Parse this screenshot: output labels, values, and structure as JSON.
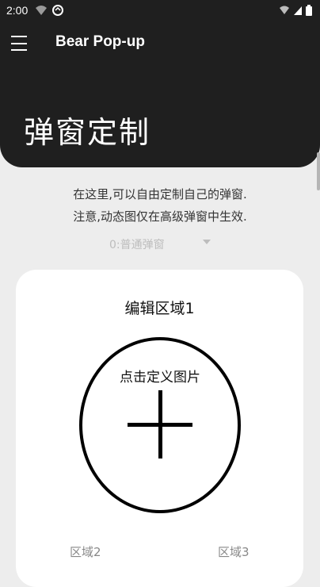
{
  "status_bar": {
    "time": "2:00",
    "left_icons": [
      "wifi-question-icon",
      "sync-icon"
    ],
    "right_icons": [
      "wifi-off-icon",
      "signal-icon",
      "battery-icon"
    ]
  },
  "app_bar": {
    "menu_icon": "hamburger-menu-icon",
    "title": "Bear Pop-up"
  },
  "hero": {
    "title": "弹窗定制"
  },
  "description": {
    "line1": "在这里,可以自由定制自己的弹窗.",
    "line2": "注意,动态图仅在高级弹窗中生效."
  },
  "dropdown": {
    "selected": "0:普通弹窗",
    "icon": "dropdown-arrow-icon"
  },
  "edit_card": {
    "title": "编辑区域1",
    "image_prompt": "点击定义图片",
    "plus_icon": "plus-icon",
    "areas": [
      "区域2",
      "区域3"
    ]
  },
  "colors": {
    "dark": "#1f1f1f",
    "background": "#ededed",
    "card": "#ffffff",
    "muted": "#bdbdbd"
  }
}
